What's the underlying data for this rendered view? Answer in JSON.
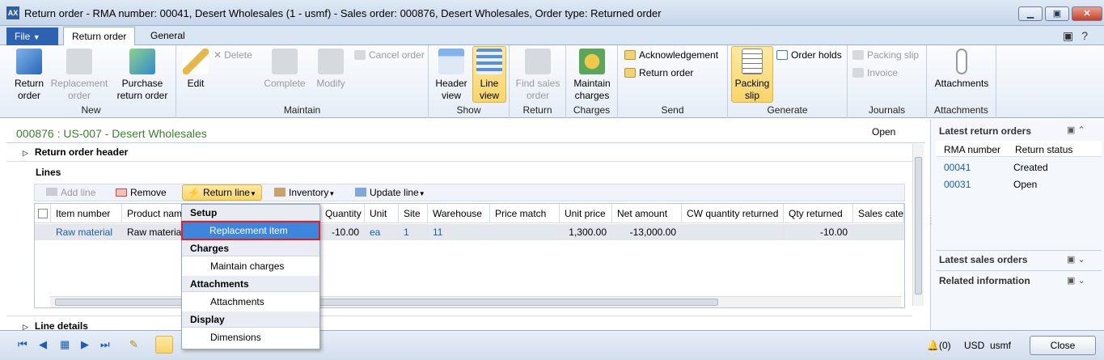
{
  "window": {
    "title": "Return order  -  RMA number: 00041,  Desert Wholesales (1 - usmf) - Sales order: 000876, Desert Wholesales, Order type: Returned order",
    "app_icon": "AX"
  },
  "tabs": {
    "file": "File",
    "return_order": "Return order",
    "general": "General"
  },
  "ribbon": {
    "new": {
      "label": "New",
      "return_order": "Return order",
      "replacement_order": "Replacement order",
      "purchase_return_order": "Purchase return order"
    },
    "maintain": {
      "label": "Maintain",
      "edit": "Edit",
      "delete": "Delete",
      "complete": "Complete",
      "modify": "Modify",
      "cancel_order": "Cancel order"
    },
    "show": {
      "label": "Show",
      "header_view": "Header view",
      "line_view": "Line view"
    },
    "return": {
      "label": "Return",
      "find_sales_order": "Find sales order"
    },
    "charges": {
      "label": "Charges",
      "maintain_charges": "Maintain charges"
    },
    "send": {
      "label": "Send",
      "acknowledgement": "Acknowledgement",
      "return_order": "Return order"
    },
    "generate": {
      "label": "Generate",
      "packing_slip": "Packing slip",
      "order_holds": "Order holds"
    },
    "journals": {
      "label": "Journals",
      "packing_slip": "Packing slip",
      "invoice": "Invoice"
    },
    "attachments": {
      "label": "Attachments",
      "attachments": "Attachments"
    }
  },
  "record": {
    "title": "000876 : US-007 - Desert Wholesales",
    "status": "Open"
  },
  "sections": {
    "header": "Return order header",
    "lines": "Lines",
    "line_details": "Line details"
  },
  "lines_toolbar": {
    "add_line": "Add line",
    "remove": "Remove",
    "return_line": "Return line",
    "inventory": "Inventory",
    "update_line": "Update line"
  },
  "grid": {
    "columns": [
      "Item number",
      "Product nam",
      "Quantity",
      "Unit",
      "Site",
      "Warehouse",
      "Price match",
      "Unit price",
      "Net amount",
      "CW quantity returned",
      "Qty returned",
      "Sales categ"
    ],
    "row": {
      "item_number": "Raw material",
      "product_name": "Raw materia",
      "quantity": "-10.00",
      "unit": "ea",
      "site": "1",
      "warehouse": "11",
      "price_match": "",
      "unit_price": "1,300.00",
      "net_amount": "-13,000.00",
      "cw_quantity_returned": "",
      "qty_returned": "-10.00"
    }
  },
  "menu": {
    "setup": "Setup",
    "replacement_item": "Replacement item",
    "charges": "Charges",
    "maintain_charges": "Maintain charges",
    "attachments": "Attachments",
    "attachments_item": "Attachments",
    "display": "Display",
    "dimensions": "Dimensions"
  },
  "factbox": {
    "latest_return_orders": "Latest return orders",
    "col_rma": "RMA number",
    "col_status": "Return status",
    "rows": [
      {
        "rma": "00041",
        "status": "Created"
      },
      {
        "rma": "00031",
        "status": "Open"
      }
    ],
    "latest_sales_orders": "Latest sales orders",
    "related_information": "Related information"
  },
  "statusbar": {
    "alerts": "(0)",
    "currency": "USD",
    "company": "usmf",
    "close": "Close"
  },
  "colors": {
    "accent": "#2d62b3",
    "highlight": "#f7d56a",
    "link": "#1a5ea8",
    "selected_menu": "#3e86dd",
    "title_green": "#3c7f2f"
  }
}
